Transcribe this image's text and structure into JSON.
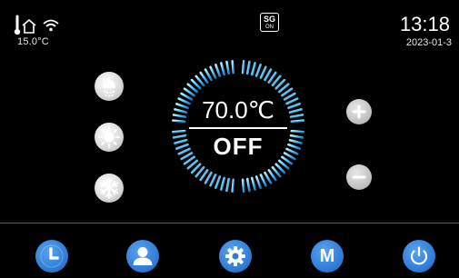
{
  "status_bar": {
    "outdoor_temp": "15.0°C",
    "sg_label": "SG",
    "sg_state": "ON",
    "time": "13:18",
    "date": "2023-01-3"
  },
  "dial": {
    "set_temperature": "70.0℃",
    "power_status": "OFF",
    "accent_gradient": [
      "#8fe0ff",
      "#2b8fd6"
    ]
  },
  "mode_icons": [
    "shower-icon",
    "sun-icon",
    "snowflake-icon"
  ],
  "nav": {
    "items": [
      "clock-icon",
      "user-icon",
      "gear-icon",
      "M",
      "power-icon"
    ],
    "mode_label": "M"
  },
  "colors": {
    "background": "#000000",
    "nav_button": "#2e7cd6",
    "dial_light": "#8fe0ff",
    "dial_dark": "#2b8fd6"
  }
}
